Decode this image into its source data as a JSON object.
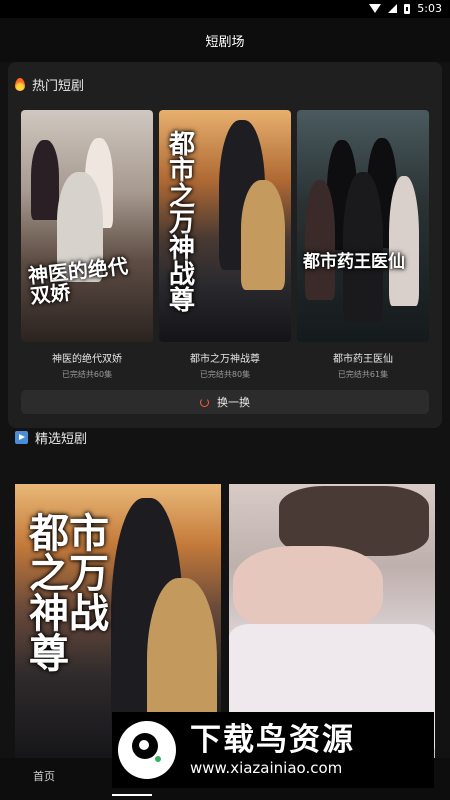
{
  "status_bar": {
    "time": "5:03"
  },
  "header": {
    "title": "短剧场"
  },
  "hot_section": {
    "title": "热门短剧",
    "dramas": [
      {
        "title": "神医的绝代双娇",
        "episodes": "已完结共60集",
        "cover_text": "神医的绝代双娇"
      },
      {
        "title": "都市之万神战尊",
        "episodes": "已完结共80集",
        "cover_text": "都市之万神战尊"
      },
      {
        "title": "都市药王医仙",
        "episodes": "已完结共61集",
        "cover_text": "都市药王医仙"
      }
    ],
    "refresh_label": "换一换"
  },
  "featured_section": {
    "title": "精选短剧",
    "items": [
      {
        "cover_text": "都市之万神战尊"
      }
    ]
  },
  "bottom_nav": {
    "home_label": "首页"
  },
  "watermark": {
    "title": "下载鸟资源",
    "url": "www.xiazainiao.com"
  }
}
